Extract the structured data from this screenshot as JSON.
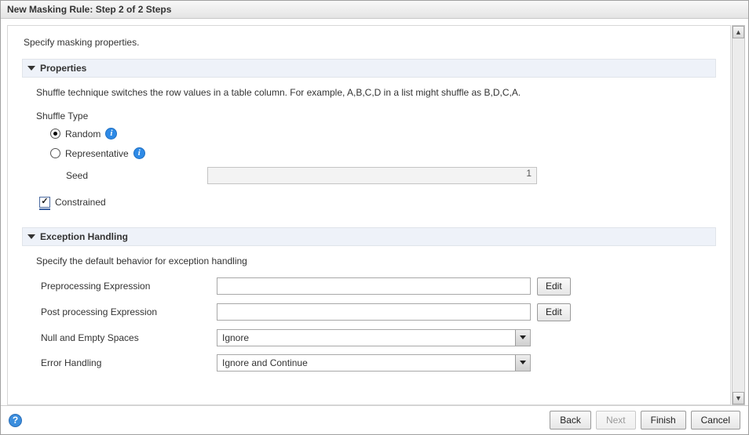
{
  "title": "New Masking Rule: Step 2 of 2 Steps",
  "intro": "Specify masking properties.",
  "properties": {
    "header": "Properties",
    "description": "Shuffle technique switches the row values in a table column. For example, A,B,C,D in a list might shuffle as B,D,C,A.",
    "shuffle_type_label": "Shuffle Type",
    "option_random": "Random",
    "option_representative": "Representative",
    "selected_option": "random",
    "seed_label": "Seed",
    "seed_value": "1",
    "constrained_label": "Constrained",
    "constrained_checked": true
  },
  "exception": {
    "header": "Exception Handling",
    "description": "Specify the default behavior for exception handling",
    "preprocessing_label": "Preprocessing Expression",
    "preprocessing_value": "",
    "postprocessing_label": "Post processing Expression",
    "postprocessing_value": "",
    "edit_label": "Edit",
    "null_label": "Null and Empty Spaces",
    "null_value": "Ignore",
    "error_label": "Error Handling",
    "error_value": "Ignore and Continue"
  },
  "footer": {
    "back": "Back",
    "next": "Next",
    "finish": "Finish",
    "cancel": "Cancel"
  }
}
